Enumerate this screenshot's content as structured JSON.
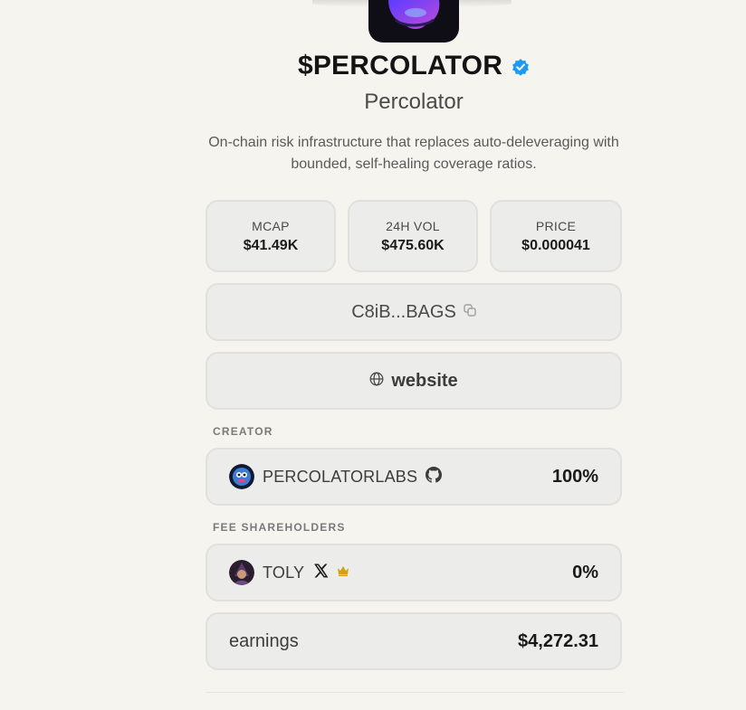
{
  "token": {
    "ticker": "$PERCOLATOR",
    "name": "Percolator",
    "description": "On-chain risk infrastructure that replaces auto-deleveraging with bounded, self-healing coverage ratios."
  },
  "stats": [
    {
      "label": "MCAP",
      "value": "$41.49K"
    },
    {
      "label": "24H VOL",
      "value": "$475.60K"
    },
    {
      "label": "PRICE",
      "value": "$0.000041"
    }
  ],
  "contract": {
    "short": "C8iB...BAGS",
    "copy_icon": "copy-icon"
  },
  "website": {
    "label": "website",
    "icon": "globe-icon"
  },
  "creator": {
    "section_label": "CREATOR",
    "name": "PERCOLATORLABS",
    "social_icon": "github-icon",
    "share": "100%"
  },
  "fee_shareholders": {
    "section_label": "FEE SHAREHOLDERS",
    "name": "TOLY",
    "social_icon": "x-icon",
    "badge_icon": "crown-icon",
    "share": "0%"
  },
  "earnings": {
    "label": "earnings",
    "value": "$4,272.31"
  },
  "colors": {
    "background": "#f5f4ee",
    "card": "#ececeb",
    "verified": "#1d9bf0",
    "crown": "#d4a017"
  }
}
